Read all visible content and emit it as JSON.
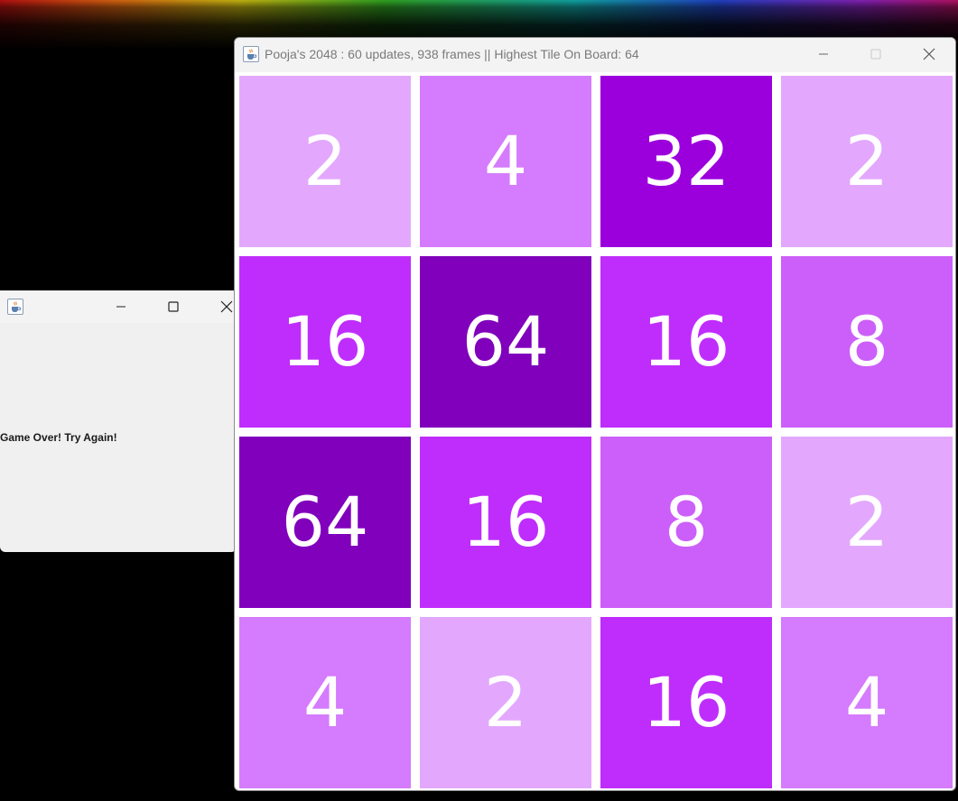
{
  "game_window": {
    "title": "Pooja's 2048 : 60 updates, 938 frames || Highest Tile On Board: 64",
    "icon": "java-cup-icon",
    "controls": [
      "minimize-icon",
      "maximize-icon",
      "close-icon"
    ],
    "board": {
      "rows": [
        [
          2,
          4,
          32,
          2
        ],
        [
          16,
          64,
          16,
          8
        ],
        [
          64,
          16,
          8,
          2
        ],
        [
          4,
          2,
          16,
          4
        ]
      ],
      "tile_colors": {
        "2": "#e3a8fd",
        "4": "#d57bfd",
        "8": "#cc5ff9",
        "16": "#bf2dfc",
        "32": "#9b00dc",
        "64": "#8000bc"
      },
      "text_color": "#ffffff"
    }
  },
  "dialog_window": {
    "icon": "java-cup-icon",
    "message": "Game Over! Try Again!",
    "controls": [
      "minimize-icon",
      "maximize-icon",
      "close-icon"
    ]
  }
}
